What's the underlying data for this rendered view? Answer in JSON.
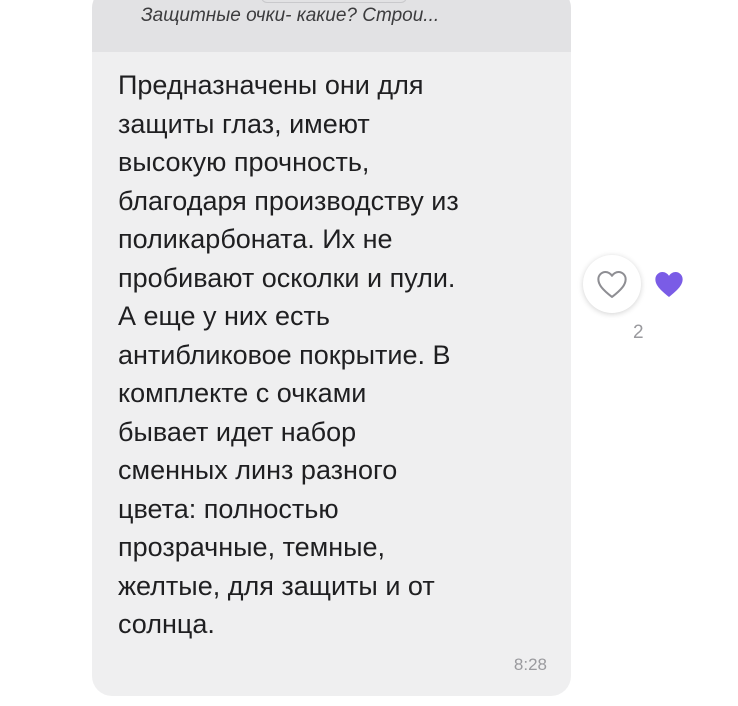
{
  "reply_quote": {
    "text": "Защитные очки- какие? Строи..."
  },
  "message": {
    "text": "Предназначены они для\nзащиты глаз, имеют\nвысокую прочность,\nблагодаря производству из\nполикарбоната. Их не\nпробивают осколки и пули.\nА еще у них есть\nантибликовое покрытие. В\nкомплекте с очками\nбывает идет набор\nсменных линз разного\nцвета: полностью\nпрозрачные, темные,\nжелтые, для защиты и от\nсолнца.",
    "time": "8:28"
  },
  "reactions": {
    "like_count": "2",
    "heart_color": "#7a5ce6",
    "outline_color": "#8e8e93"
  }
}
